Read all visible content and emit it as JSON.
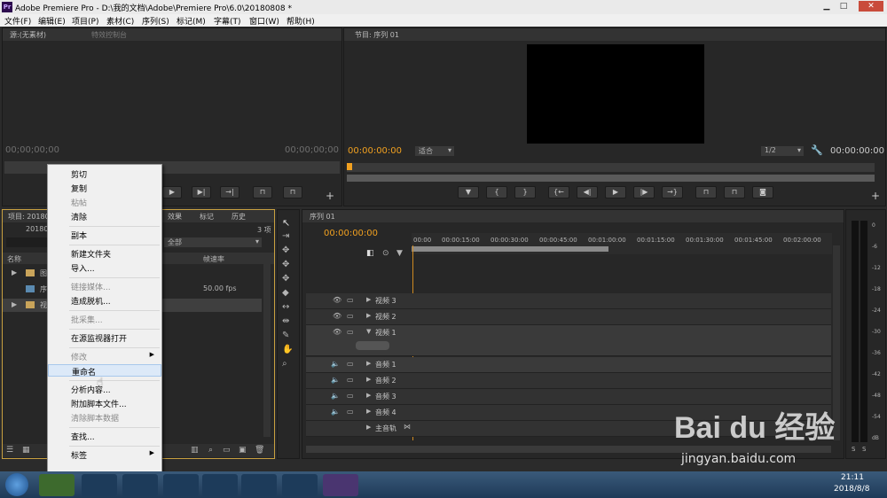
{
  "window": {
    "title": "Adobe Premiere Pro - D:\\我的文档\\Adobe\\Premiere Pro\\6.0\\20180808 *",
    "app_icon": "Pr",
    "min": "▁",
    "max": "□",
    "close": "✕"
  },
  "menubar": [
    "文件(F)",
    "编辑(E)",
    "项目(P)",
    "素材(C)",
    "序列(S)",
    "标记(M)",
    "字幕(T)",
    "窗口(W)",
    "帮助(H)"
  ],
  "source_panel": {
    "tab": "源:(无素材)",
    "tab2": "特效控制台",
    "timecode_left": "00;00;00;00",
    "timecode_right": "00;00;00;00"
  },
  "program_panel": {
    "tab": "节目: 序列 01",
    "timecode_left": "00:00:00:00",
    "fit": "适合",
    "scale": "1/2",
    "timecode_right": "00:00:00:00"
  },
  "project_panel": {
    "tab": "项目: 20180808",
    "tab_short": "项目: 20180",
    "file": "20180",
    "items_count": "3 项",
    "filter": "全部",
    "col_name": "名称",
    "col_framerate": "帧速率",
    "rows": [
      {
        "name": "图",
        "fps": ""
      },
      {
        "name": "序",
        "fps": "50.00 fps"
      },
      {
        "name": "视",
        "fps": ""
      }
    ],
    "tabs": [
      "效果",
      "标记",
      "历史"
    ]
  },
  "timeline": {
    "tab": "序列 01",
    "timecode": "00:00:00:00",
    "ruler": [
      "00:00",
      "00:00:15:00",
      "00:00:30:00",
      "00:00:45:00",
      "00:01:00:00",
      "00:01:15:00",
      "00:01:30:00",
      "00:01:45:00",
      "00:02:00:00"
    ],
    "video_tracks": [
      "视频 3",
      "视频 2",
      "视频 1"
    ],
    "audio_tracks": [
      "音频 1",
      "音频 2",
      "音频 3",
      "音频 4"
    ],
    "master": "主音轨"
  },
  "meter": {
    "labels": [
      "0",
      "-6",
      "-12",
      "-18",
      "-24",
      "-30",
      "-36",
      "-42",
      "-48",
      "-54",
      "dB"
    ],
    "solo": "S"
  },
  "context_menu": [
    {
      "label": "剪切",
      "disabled": false
    },
    {
      "label": "复制",
      "disabled": false
    },
    {
      "label": "粘帖",
      "disabled": true
    },
    {
      "label": "清除",
      "disabled": false
    },
    {
      "sep": true
    },
    {
      "label": "副本",
      "disabled": false
    },
    {
      "sep": true
    },
    {
      "label": "新建文件夹",
      "disabled": false
    },
    {
      "label": "导入...",
      "disabled": false
    },
    {
      "sep": true
    },
    {
      "label": "链接媒体...",
      "disabled": true
    },
    {
      "label": "造成脱机...",
      "disabled": false
    },
    {
      "sep": true
    },
    {
      "label": "批采集...",
      "disabled": true
    },
    {
      "sep": true
    },
    {
      "label": "在源监视器打开",
      "disabled": false
    },
    {
      "sep": true
    },
    {
      "label": "修改",
      "disabled": true,
      "submenu": true
    },
    {
      "label": "重命名",
      "disabled": false,
      "highlight": true
    },
    {
      "sep": true
    },
    {
      "label": "分析内容...",
      "disabled": false
    },
    {
      "label": "附加脚本文件...",
      "disabled": false
    },
    {
      "label": "清除脚本数据",
      "disabled": true
    },
    {
      "sep": true
    },
    {
      "label": "查找...",
      "disabled": false
    },
    {
      "sep": true
    },
    {
      "label": "标签",
      "disabled": false,
      "submenu": true
    }
  ],
  "taskbar": {
    "time": "21:11",
    "date": "2018/8/8"
  },
  "watermark": {
    "brand": "Bai du 经验",
    "url": "jingyan.baidu.com"
  },
  "colors": {
    "accent": "#f0a020",
    "panel": "#272727",
    "menu_bg": "#f0f0f0",
    "highlight": "#dce9f8"
  }
}
